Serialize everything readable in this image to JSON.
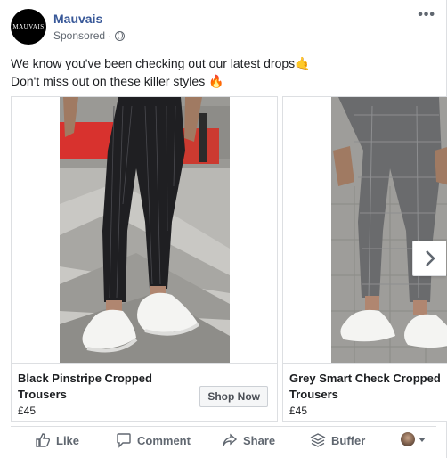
{
  "post": {
    "page_name": "Mauvais",
    "avatar_text": "MAUVAIS",
    "sponsored": "Sponsored · ",
    "more": "•••",
    "text_line1": "We know you've been checking out our latest drops🤙",
    "text_line2": "Don't miss out on these killer styles 🔥"
  },
  "carousel": {
    "cards": [
      {
        "title_line1": "Black Pinstripe Cropped",
        "title_line2": "Trousers",
        "price": "£45",
        "button": "Shop Now"
      },
      {
        "title_line1": "Grey Smart Check Cropped",
        "title_line2": "Trousers",
        "price": "£45"
      }
    ]
  },
  "actions": {
    "like": "Like",
    "comment": "Comment",
    "share": "Share",
    "buffer": "Buffer"
  },
  "colors": {
    "link": "#385898",
    "secondary_text": "#606770",
    "border": "#dddfe2"
  }
}
